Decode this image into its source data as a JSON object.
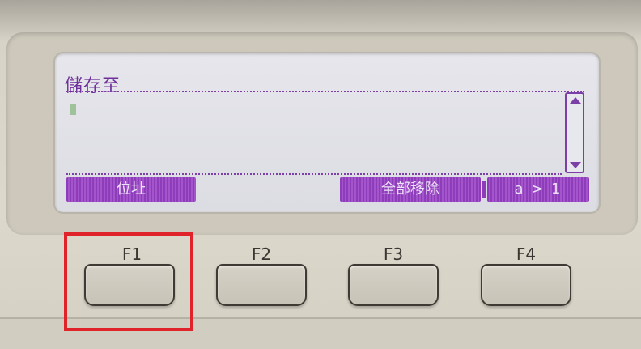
{
  "screen": {
    "title": "儲存至",
    "scroll_up_icon": "triangle-up-icon",
    "scroll_down_icon": "triangle-down-icon"
  },
  "softkeys": {
    "f1": "位址",
    "f3": "全部移除",
    "f4": "a > 1"
  },
  "function_buttons": [
    {
      "label": "F1"
    },
    {
      "label": "F2"
    },
    {
      "label": "F3"
    },
    {
      "label": "F4"
    }
  ],
  "colors": {
    "lcd_accent": "#8e3dba",
    "highlight": "#e0232b"
  }
}
